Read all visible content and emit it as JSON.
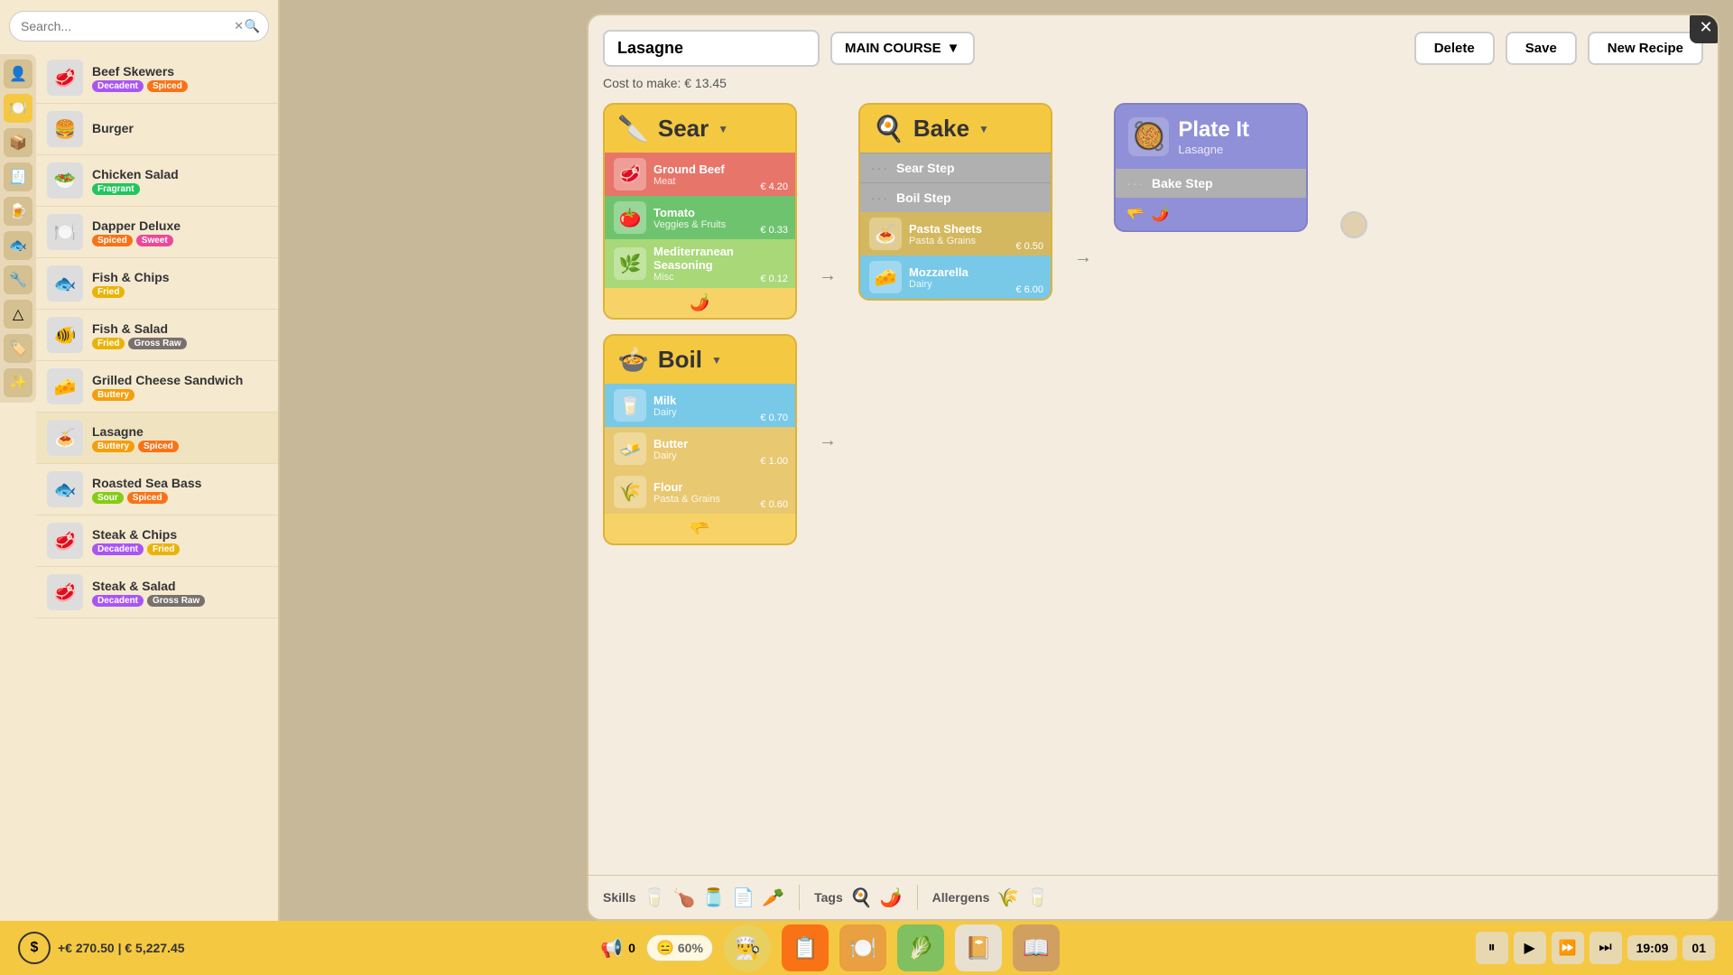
{
  "sidebar": {
    "search_placeholder": "Search...",
    "recipes": [
      {
        "name": "Beef Skewers",
        "tags": [
          "Decadent",
          "Spiced"
        ],
        "icon": "🥩",
        "tag_classes": [
          "decadent",
          "spiced"
        ]
      },
      {
        "name": "Burger",
        "tags": [],
        "icon": "🍔",
        "tag_classes": []
      },
      {
        "name": "Chicken Salad",
        "tags": [
          "Fragrant"
        ],
        "icon": "🥗",
        "tag_classes": [
          "fragrant"
        ]
      },
      {
        "name": "Dapper Deluxe",
        "tags": [
          "Spiced",
          "Sweet"
        ],
        "icon": "🍽️",
        "tag_classes": [
          "spiced",
          "sweet"
        ]
      },
      {
        "name": "Fish & Chips",
        "tags": [
          "Fried"
        ],
        "icon": "🐟",
        "tag_classes": [
          "fried"
        ]
      },
      {
        "name": "Fish & Salad",
        "tags": [
          "Fried",
          "Gross Raw"
        ],
        "icon": "🐠",
        "tag_classes": [
          "fried",
          "gross-raw"
        ]
      },
      {
        "name": "Grilled Cheese Sandwich",
        "tags": [
          "Buttery"
        ],
        "icon": "🧀",
        "tag_classes": [
          "buttery"
        ]
      },
      {
        "name": "Lasagne",
        "tags": [
          "Buttery",
          "Spiced"
        ],
        "icon": "🍝",
        "tag_classes": [
          "buttery",
          "spiced"
        ],
        "active": true
      },
      {
        "name": "Roasted Sea Bass",
        "tags": [
          "Sour",
          "Spiced"
        ],
        "icon": "🐟",
        "tag_classes": [
          "sour",
          "spiced"
        ]
      },
      {
        "name": "Steak & Chips",
        "tags": [
          "Decadent",
          "Fried"
        ],
        "icon": "🥩",
        "tag_classes": [
          "decadent",
          "fried"
        ]
      },
      {
        "name": "Steak & Salad",
        "tags": [
          "Decadent",
          "Gross Raw"
        ],
        "icon": "🥩",
        "tag_classes": [
          "decadent",
          "gross-raw"
        ]
      }
    ]
  },
  "editor": {
    "recipe_name": "Lasagne",
    "course": "MAIN COURSE",
    "cost": "Cost to make: € 13.45",
    "btn_delete": "Delete",
    "btn_save": "Save",
    "btn_new_recipe": "New Recipe",
    "sear_step": {
      "title": "Sear",
      "icon": "🔪",
      "ingredients": [
        {
          "name": "Ground Beef",
          "category": "Meat",
          "price": "€ 4.20",
          "icon": "🥩",
          "color": "meat"
        },
        {
          "name": "Tomato",
          "category": "Veggies & Fruits",
          "price": "€ 0.33",
          "icon": "🍅",
          "color": "veggie"
        },
        {
          "name": "Mediterranean Seasoning",
          "category": "Misc",
          "price": "€ 0.12",
          "icon": "🌿",
          "color": "misc"
        }
      ]
    },
    "boil_step": {
      "title": "Boil",
      "icon": "🍲",
      "ingredients": [
        {
          "name": "Milk",
          "category": "Dairy",
          "price": "€ 0.70",
          "icon": "🥛",
          "color": "dairy"
        },
        {
          "name": "Butter",
          "category": "Dairy",
          "price": "€ 1.00",
          "icon": "🧈",
          "color": "dairy"
        },
        {
          "name": "Flour",
          "category": "Pasta & Grains",
          "price": "€ 0.60",
          "icon": "🌾",
          "color": "grains"
        }
      ]
    },
    "bake_step": {
      "title": "Bake",
      "icon": "🍳",
      "sub_steps": [
        {
          "label": "Sear Step",
          "dots": "···"
        },
        {
          "label": "Boil Step",
          "dots": "···"
        }
      ],
      "ingredients": [
        {
          "name": "Pasta Sheets",
          "category": "Pasta & Grains",
          "price": "€ 0.50",
          "icon": "🍝",
          "color": "pasta"
        },
        {
          "name": "Mozzarella",
          "category": "Dairy",
          "price": "€ 6.00",
          "icon": "🧀",
          "color": "dairy"
        }
      ]
    },
    "plate_step": {
      "title": "Plate It",
      "subtitle": "Lasagne",
      "icon": "🥘",
      "sub_steps": [
        {
          "label": "Bake Step",
          "dots": "···"
        }
      ]
    }
  },
  "skills_section": {
    "label": "Skills"
  },
  "tags_section": {
    "label": "Tags"
  },
  "allergens_section": {
    "label": "Allergens"
  },
  "taskbar": {
    "income": "+€ 270.50",
    "balance": "€ 5,227.45",
    "alert_count": "0",
    "satisfaction": "60%",
    "time": "19:09",
    "date": "01"
  }
}
